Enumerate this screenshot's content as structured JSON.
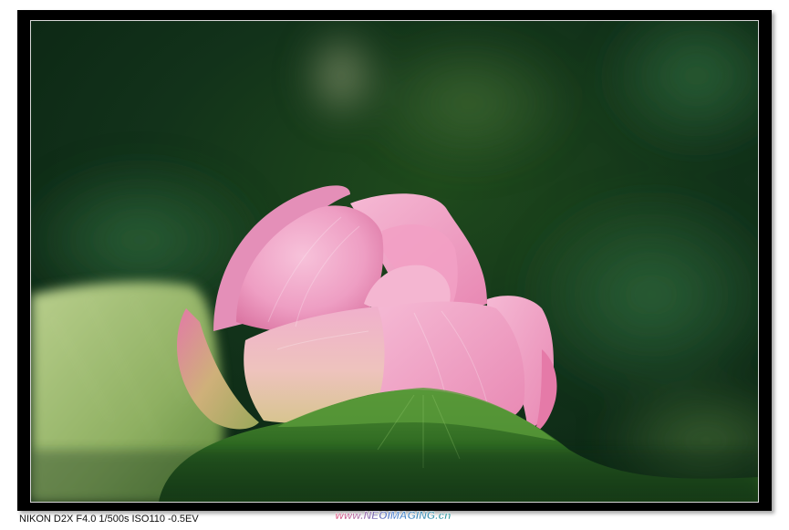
{
  "photo": {
    "subject": "pink-lotus-bud-icon"
  },
  "caption": {
    "exif_text": "NIKON D2X F4.0 1/500s ISO110 -0.5EV"
  },
  "watermark": {
    "text": "www.NEOIMAGING.cn"
  },
  "colors": {
    "frame": "#000000",
    "background": "#ffffff",
    "petal_pink": "#f1a6c8",
    "leaf_green": "#3f7a2a"
  }
}
